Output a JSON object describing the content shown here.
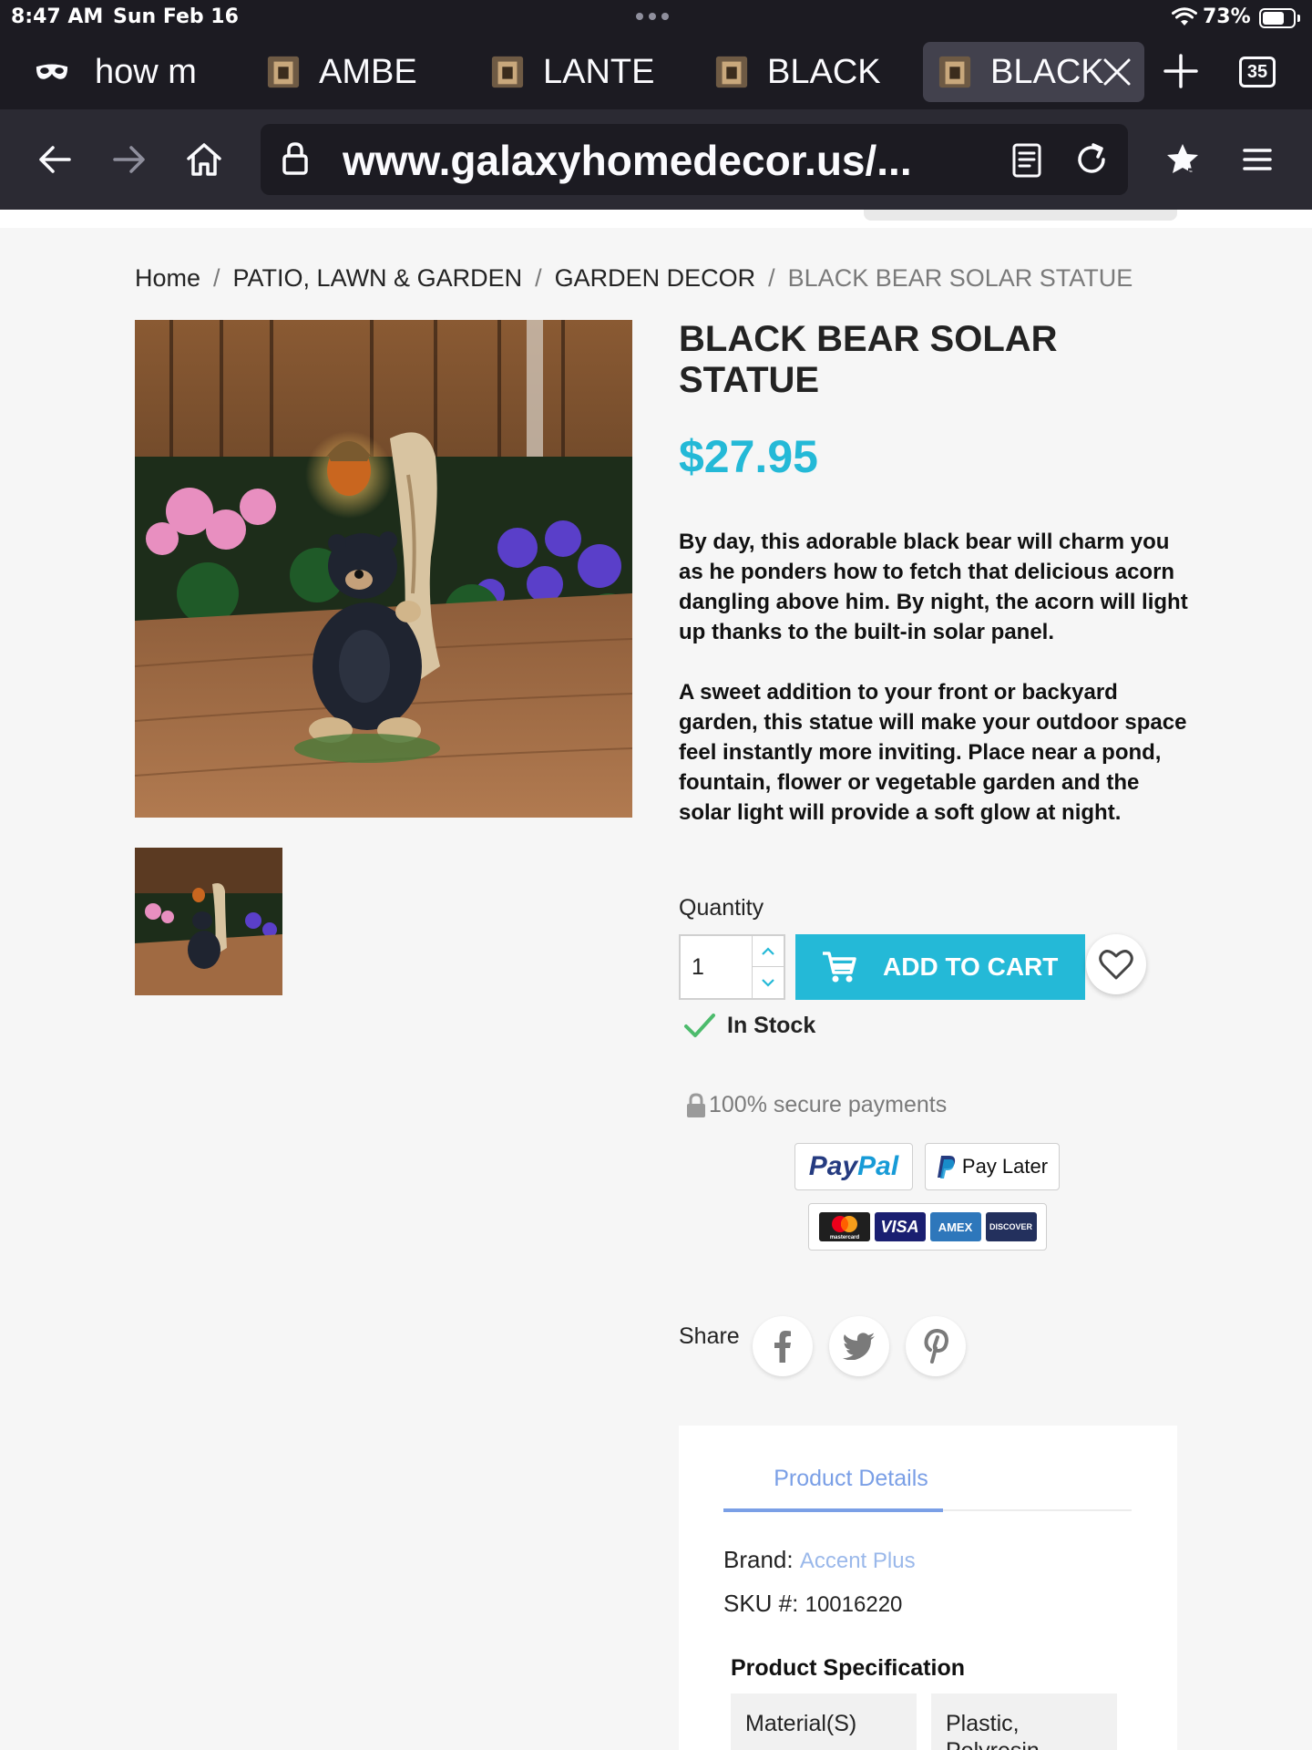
{
  "status_bar": {
    "time": "8:47 AM",
    "date": "Sun Feb 16",
    "battery_percent": "73%",
    "battery_level": 0.73
  },
  "tabs": [
    {
      "label": "how m",
      "favicon": "private-mask-icon",
      "active": false
    },
    {
      "label": "AMBE",
      "favicon": "site-favicon-icon",
      "active": false
    },
    {
      "label": "LANTE",
      "favicon": "site-favicon-icon",
      "active": false
    },
    {
      "label": "BLACK",
      "favicon": "site-favicon-icon",
      "active": false
    },
    {
      "label": "BLACK",
      "favicon": "site-favicon-icon",
      "active": true
    }
  ],
  "tab_count": "35",
  "url": "www.galaxyhomedecor.us/...",
  "breadcrumb": {
    "items": [
      "Home",
      "PATIO, LAWN & GARDEN",
      "GARDEN DECOR"
    ],
    "current": "BLACK BEAR SOLAR STATUE",
    "separator": "/"
  },
  "product": {
    "title": "BLACK BEAR SOLAR STATUE",
    "price": "$27.95",
    "description": [
      "By day, this adorable black bear will charm you as he ponders how to fetch that delicious acorn dangling above him. By night, the acorn will light up thanks to the built-in solar panel.",
      "A sweet addition to your front or backyard garden, this statue will make your outdoor space feel instantly more inviting. Place near a pond, fountain, flower or vegetable garden and the solar light will provide a soft glow at night."
    ],
    "quantity_label": "Quantity",
    "quantity_value": "1",
    "add_to_cart_label": "ADD TO CART",
    "stock_status": "In Stock",
    "secure_payments": "100% secure payments"
  },
  "payments": {
    "paypal_pay": "Pay",
    "paypal_pal": "Pal",
    "pay_later": "Pay Later",
    "cards": [
      "mastercard",
      "VISA",
      "AMEX",
      "DISCOVER"
    ]
  },
  "share": {
    "label": "Share",
    "networks": [
      "facebook-icon",
      "twitter-icon",
      "pinterest-icon"
    ]
  },
  "details": {
    "tab_label": "Product Details",
    "brand_label": "Brand:",
    "brand_value": "Accent Plus",
    "sku_label": "SKU #:",
    "sku_value": "10016220",
    "spec_title": "Product Specification",
    "spec_rows": [
      {
        "name": "Material(S)",
        "value": "Plastic, Polyresin"
      }
    ]
  },
  "colors": {
    "accent": "#24b9d7",
    "browser_chrome": "#1c1b22",
    "in_stock_check": "#4cbb6c",
    "details_tab": "#7a9fe6"
  }
}
